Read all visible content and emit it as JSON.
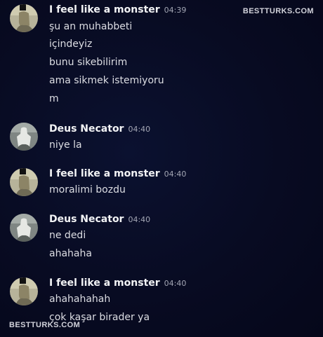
{
  "watermark": {
    "top": "BESTTURKS.COM",
    "bottom": "BESTTURKS.COM"
  },
  "messages": [
    {
      "author": "I feel like a monster",
      "time": "04:39",
      "lines": [
        "şu an muhabbeti",
        "içindeyiz",
        "bunu sikebilirim",
        "ama sikmek istemiyoru",
        "m"
      ]
    },
    {
      "author": "Deus Necator",
      "time": "04:40",
      "lines": [
        "niye la"
      ]
    },
    {
      "author": "I feel like a monster",
      "time": "04:40",
      "lines": [
        "moralimi bozdu"
      ]
    },
    {
      "author": "Deus Necator",
      "time": "04:40",
      "lines": [
        "ne dedi",
        "ahahaha"
      ]
    },
    {
      "author": "I feel like a monster",
      "time": "04:40",
      "lines": [
        "ahahahahah",
        "çok kaşar birader ya"
      ]
    }
  ]
}
